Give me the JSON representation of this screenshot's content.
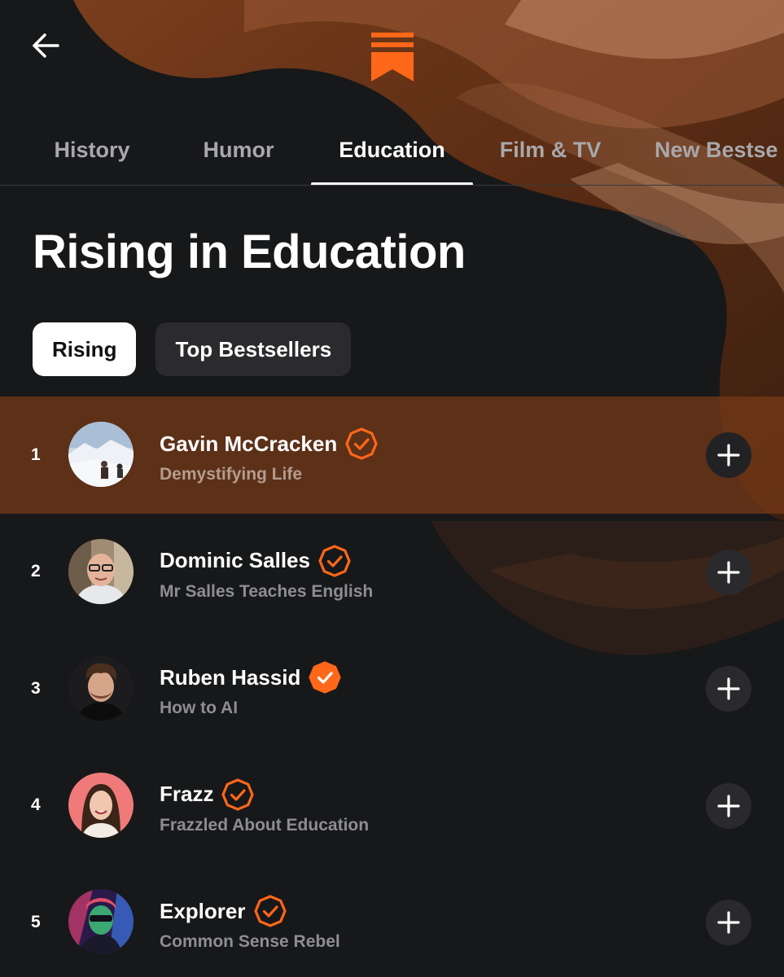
{
  "colors": {
    "background": "#17181a",
    "accent": "#ff6719",
    "highlight_row": "#783a18",
    "chip_active_bg": "#ffffff",
    "chip_inactive_bg": "#2b2b2e",
    "muted_text": "#8e8e92"
  },
  "header": {
    "back_icon": "arrow-left-icon",
    "logo_icon": "substack-logo-icon"
  },
  "tabs": [
    {
      "label": "History",
      "active": false
    },
    {
      "label": "Humor",
      "active": false
    },
    {
      "label": "Education",
      "active": true
    },
    {
      "label": "Film & TV",
      "active": false
    },
    {
      "label": "New Bestse",
      "active": false
    }
  ],
  "page": {
    "title": "Rising in Education"
  },
  "filters": [
    {
      "label": "Rising",
      "active": true
    },
    {
      "label": "Top Bestsellers",
      "active": false
    }
  ],
  "rows": [
    {
      "rank": "1",
      "name": "Gavin McCracken",
      "publication": "Demystifying Life",
      "verified": true,
      "highlighted": true,
      "action_icon": "plus-icon"
    },
    {
      "rank": "2",
      "name": "Dominic Salles",
      "publication": "Mr Salles Teaches English",
      "verified": true,
      "highlighted": false,
      "action_icon": "plus-icon"
    },
    {
      "rank": "3",
      "name": "Ruben Hassid",
      "publication": "How to AI",
      "verified": true,
      "highlighted": false,
      "action_icon": "plus-icon"
    },
    {
      "rank": "4",
      "name": "Frazz",
      "publication": "Frazzled About Education",
      "verified": true,
      "highlighted": false,
      "action_icon": "plus-icon"
    },
    {
      "rank": "5",
      "name": "Explorer",
      "publication": "Common Sense Rebel",
      "verified": true,
      "highlighted": false,
      "action_icon": "plus-icon"
    }
  ]
}
